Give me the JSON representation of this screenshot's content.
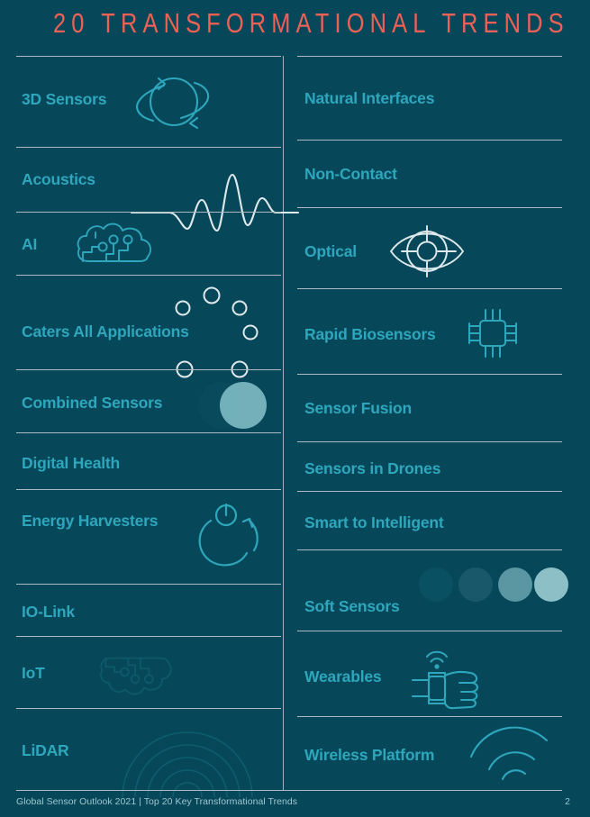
{
  "document": {
    "title": "20 TRANSFORMATIONAL TRENDS",
    "background_color": "#06485a",
    "title_color": "#ef6155",
    "label_color": "#2ea6bc",
    "rule_color": "#a9bcc1",
    "icon_teal": "#2ea6bc",
    "icon_white": "#e8eff1"
  },
  "footer": {
    "left_text": "Global Sensor Outlook 2021  |  Top 20 Key Transformational Trends",
    "page_number": "2"
  },
  "columns": {
    "left": {
      "items": [
        {
          "label": "3D Sensors",
          "icon": "orbit-planet-icon"
        },
        {
          "label": "Acoustics",
          "icon": "sound-waveform-icon"
        },
        {
          "label": "AI",
          "icon": "brain-circuit-cloud-icon"
        },
        {
          "label": "Caters All Applications",
          "icon": "rising-bubbles-icon"
        },
        {
          "label": "Combined Sensors",
          "icon": "overlapping-circles-icon"
        },
        {
          "label": "Digital Health",
          "icon": "none"
        },
        {
          "label": "Energy Harvesters",
          "icon": "power-recycle-icon"
        },
        {
          "label": "IO-Link",
          "icon": "none"
        },
        {
          "label": "IoT",
          "icon": "brain-circuit-cloud-faint-icon"
        },
        {
          "label": "LiDAR",
          "icon": "concentric-arcs-faint-icon"
        }
      ]
    },
    "right": {
      "items": [
        {
          "label": "Natural Interfaces",
          "icon": "none"
        },
        {
          "label": "Non-Contact",
          "icon": "none"
        },
        {
          "label": "Optical",
          "icon": "eye-target-icon"
        },
        {
          "label": "Rapid Biosensors",
          "icon": "microchip-icon"
        },
        {
          "label": "Sensor Fusion",
          "icon": "none"
        },
        {
          "label": "Sensors in Drones",
          "icon": "none"
        },
        {
          "label": "Smart to Intelligent",
          "icon": "none"
        },
        {
          "label": "Soft Sensors",
          "icon": "gradient-dots-icon"
        },
        {
          "label": "Wearables",
          "icon": "smartwatch-fist-icon"
        },
        {
          "label": "Wireless Platform",
          "icon": "wifi-arcs-icon"
        }
      ]
    }
  }
}
